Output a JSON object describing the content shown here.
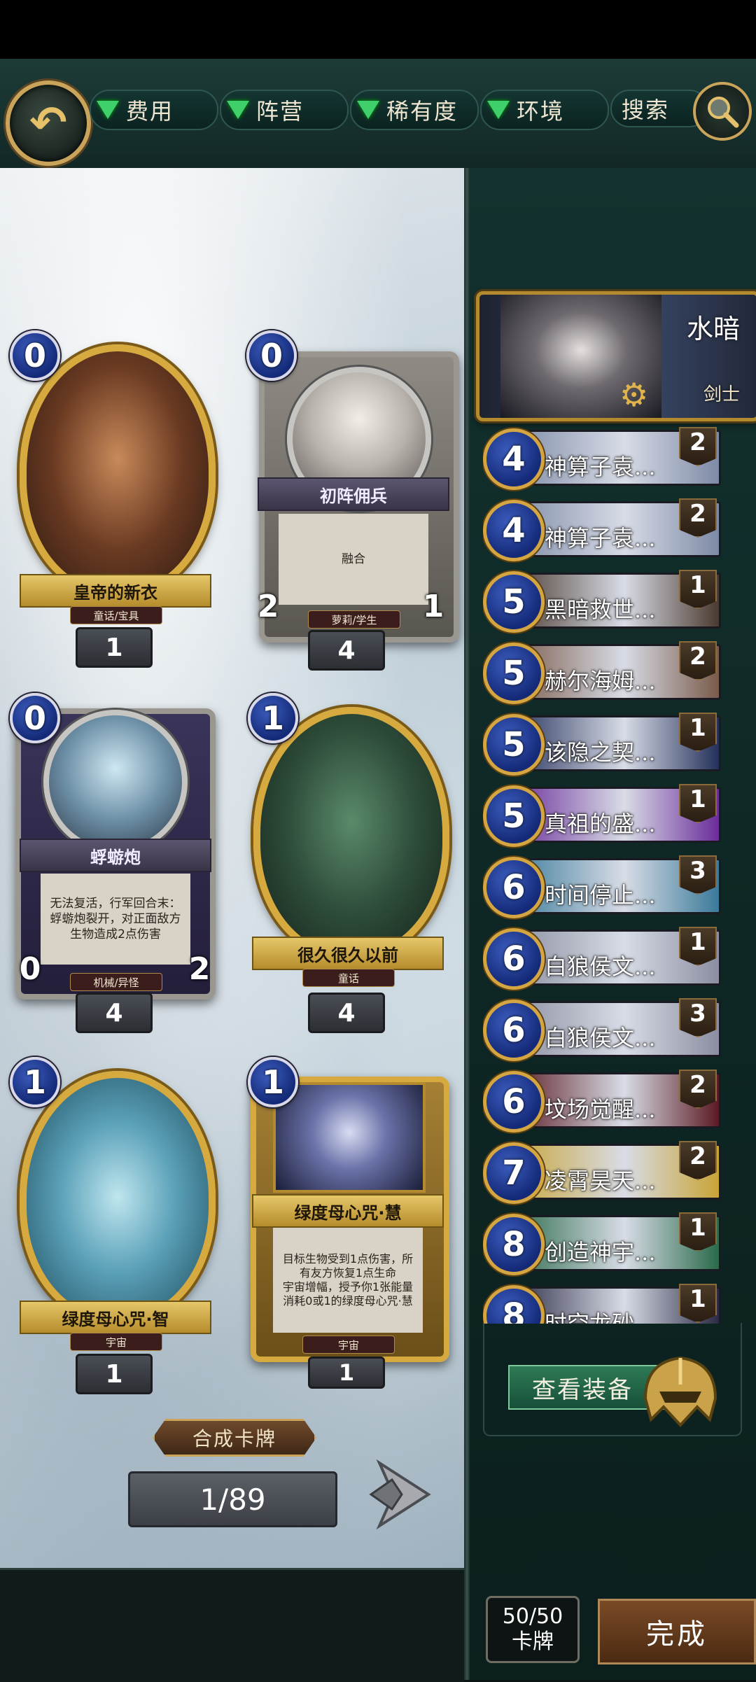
{
  "filters": {
    "back_icon": "return-arrow-icon",
    "items": [
      {
        "label": "费用"
      },
      {
        "label": "阵营"
      },
      {
        "label": "稀有度"
      },
      {
        "label": "环境"
      }
    ],
    "search_label": "搜索"
  },
  "collection": {
    "cards": [
      {
        "cost": "0",
        "name": "皇帝的新衣",
        "tribe": "童话/宝具",
        "count": "1"
      },
      {
        "cost": "0",
        "name": "初阵佣兵",
        "tribe": "萝莉/学生",
        "text": "融合",
        "attack": "2",
        "health": "1",
        "count": "4"
      },
      {
        "cost": "0",
        "name": "蜉蝣炮",
        "tribe": "机械/异怪",
        "text": "无法复活，行军回合末：蜉蝣炮裂开，对正面敌方生物造成2点伤害",
        "attack": "0",
        "health": "2",
        "count": "4"
      },
      {
        "cost": "1",
        "name": "很久很久以前",
        "tribe": "童话",
        "count": "4"
      },
      {
        "cost": "1",
        "name": "绿度母心咒·智",
        "tribe": "宇宙",
        "count": "1"
      },
      {
        "cost": "1",
        "name": "绿度母心咒·慧",
        "tribe": "宇宙",
        "text": "目标生物受到1点伤害，所有友方恢复1点生命\n宇宙增幅，授予你1张能量消耗0或1的绿度母心咒·慧",
        "count": "1"
      }
    ],
    "craft_label": "合成卡牌",
    "page": "1/89"
  },
  "deck": {
    "hero": {
      "name": "水暗",
      "class": "剑士"
    },
    "cards": [
      {
        "cost": "4",
        "name": "神算子袁...",
        "qty": "2",
        "color": "#7d8aa6"
      },
      {
        "cost": "4",
        "name": "神算子袁...",
        "qty": "2",
        "color": "#7d8aa6"
      },
      {
        "cost": "5",
        "name": "黑暗救世...",
        "qty": "1",
        "color": "#4a3a30"
      },
      {
        "cost": "5",
        "name": "赫尔海姆...",
        "qty": "2",
        "color": "#7a5a4a"
      },
      {
        "cost": "5",
        "name": "该隐之契...",
        "qty": "1",
        "color": "#24305a"
      },
      {
        "cost": "5",
        "name": "真祖的盛...",
        "qty": "1",
        "color": "#6a2c9a"
      },
      {
        "cost": "6",
        "name": "时间停止...",
        "qty": "3",
        "color": "#3a7a9a"
      },
      {
        "cost": "6",
        "name": "白狼侯文...",
        "qty": "1",
        "color": "#8a8ea0"
      },
      {
        "cost": "6",
        "name": "白狼侯文...",
        "qty": "3",
        "color": "#8a8ea0"
      },
      {
        "cost": "6",
        "name": "坟场觉醒...",
        "qty": "2",
        "color": "#5a1a22"
      },
      {
        "cost": "7",
        "name": "凌霄昊天...",
        "qty": "2",
        "color": "#c8a436"
      },
      {
        "cost": "8",
        "name": "创造神宇...",
        "qty": "1",
        "color": "#2a6a4a"
      },
      {
        "cost": "8",
        "name": "时空龙砂...",
        "qty": "1",
        "color": "#2a2a44"
      }
    ],
    "equipment_label": "查看装备",
    "count_value": "50/50",
    "count_unit": "卡牌",
    "done_label": "完成"
  }
}
